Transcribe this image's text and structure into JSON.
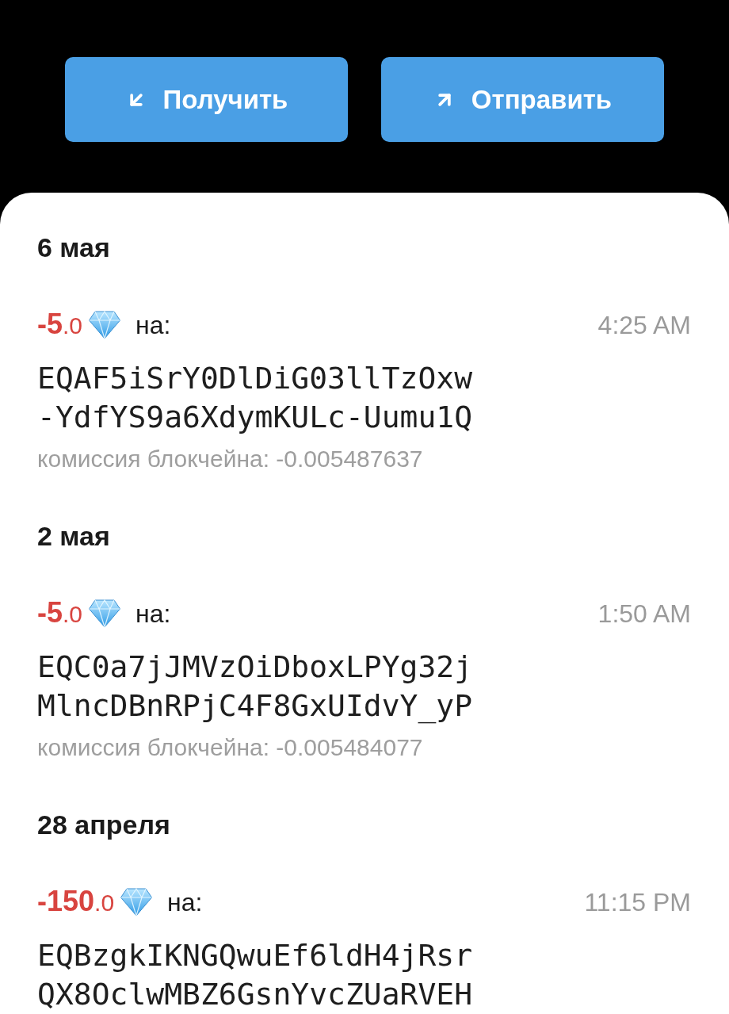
{
  "actions": [
    {
      "kind": "receive",
      "label": "Получить"
    },
    {
      "kind": "send",
      "label": "Отправить"
    }
  ],
  "history": [
    {
      "date": "6 мая",
      "transactions": [
        {
          "amount": "**-5**.0",
          "counterparty_label": "на:",
          "time": "4:25 AM",
          "address": "EQAF5iSrY0DlDiG03llTzOxw-YdfYS9a6XdymKULc-Uumu1Q",
          "fee": "комиссия блокчейна: -0.005487637"
        }
      ]
    },
    {
      "date": "2 мая",
      "transactions": [
        {
          "amount": "**-5**.0",
          "counterparty_label": "на:",
          "time": "1:50 AM",
          "address": "EQC0a7jJMVzOiDboxLPYg32jMlncDBnRPjC4F8GxUIdvY_yP",
          "fee": "комиссия блокчейна: -0.005484077"
        }
      ]
    },
    {
      "date": "28 апреля",
      "transactions": [
        {
          "amount": "**-150**.0",
          "counterparty_label": "на:",
          "time": "11:15 PM",
          "address": "EQBzgkIKNGQwuEf6ldH4jRsrQX8OclwMBZ6GsnYvcZUaRVEH"
        }
      ]
    }
  ]
}
